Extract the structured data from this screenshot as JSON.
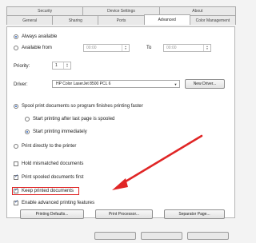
{
  "tabs_top": [
    "Security",
    "Device Settings",
    "About"
  ],
  "tabs_bottom": [
    "General",
    "Sharing",
    "Ports",
    "Advanced",
    "Color Management"
  ],
  "availability": {
    "always_label": "Always available",
    "from_label": "Available from",
    "from_value": "00:00",
    "to_label": "To",
    "to_value": "00:00"
  },
  "priority": {
    "label": "Priority:",
    "value": "1"
  },
  "driver": {
    "label": "Driver:",
    "value": "HP Color LaserJet 8500 PCL 6",
    "new_driver_label": "New Driver..."
  },
  "spool": {
    "spool_label": "Spool print documents so program finishes printing faster",
    "after_last_label": "Start printing after last page is spooled",
    "immediately_label": "Start printing immediately",
    "direct_label": "Print directly to the printer"
  },
  "options": {
    "hold_label": "Hold mismatched documents",
    "spooled_first_label": "Print spooled documents first",
    "keep_label": "Keep printed documents",
    "advanced_label": "Enable advanced printing features"
  },
  "buttons": {
    "defaults_label": "Printing Defaults...",
    "processor_label": "Print Processor...",
    "separator_label": "Separator Page..."
  },
  "annotation": {
    "arrow_color": "#e02525"
  }
}
